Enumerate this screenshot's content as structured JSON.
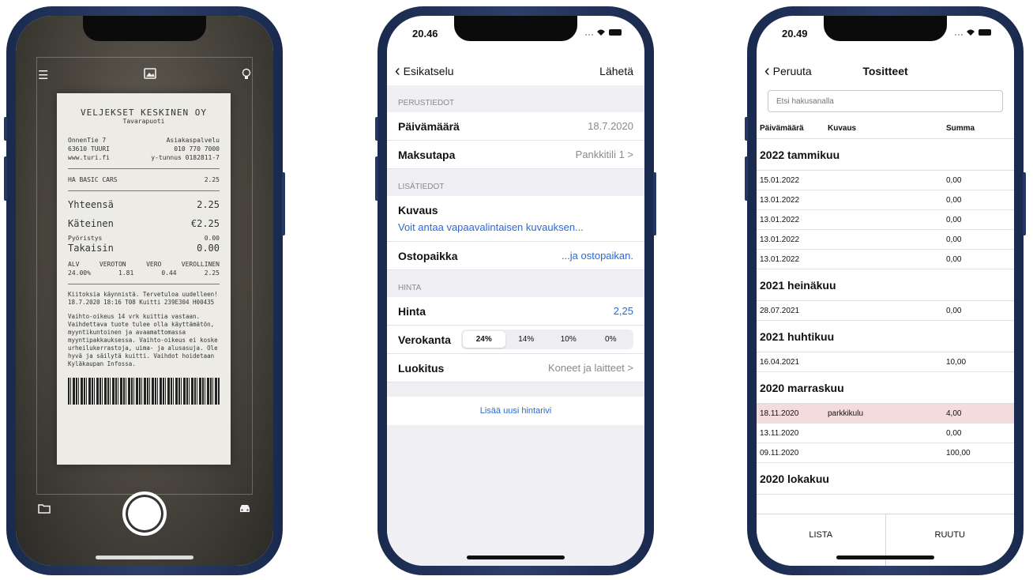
{
  "phone1": {
    "receipt": {
      "company": "VELJEKSET KESKINEN OY",
      "dept": "Tavarapuoti",
      "addr1": "OnnenTie 7",
      "addr2": "63610 TUURI",
      "web": "www.turi.fi",
      "cs1": "Asiakaspalvelu",
      "cs2": "010 770 7000",
      "ytunnus": "y-tunnus 0182811-7",
      "item": "HA BASIC CARS",
      "item_price": "2.25",
      "total_label": "Yhteensä",
      "total": "2.25",
      "cash_label": "Käteinen",
      "cash": "€2.25",
      "round_label": "Pyöristys",
      "round": "0.00",
      "back_label": "Takaisin",
      "back": "0.00",
      "tax_h1": "ALV",
      "tax_h2": "VEROTON",
      "tax_h3": "VERO",
      "tax_h4": "VEROLLINEN",
      "tax_v1": "24.00%",
      "tax_v2": "1.81",
      "tax_v3": "0.44",
      "tax_v4": "2.25",
      "thanks": "Kiitoksia käynnistä. Tervetuloa uudelleen! 18.7.2020 18:16 T08 Kuitti 239E304 H00435",
      "policy": "Vaihto-oikeus 14 vrk kuittia vastaan. Vaihdettava tuote tulee olla käyttämätön, myyntikuntoinen ja avaamattomassa myyntipakkauksessa. Vaihto-oikeus ei koske urheilukerrastoja, uima- ja alusasuja. Ole hyvä ja säilytä kuitti. Vaihdot hoidetaan Kyläkaupan Infossa."
    }
  },
  "phone2": {
    "time": "20.46",
    "back_label": "Esikatselu",
    "send_label": "Lähetä",
    "sec_basic": "PERUSTIEDOT",
    "date_label": "Päivämäärä",
    "date_value": "18.7.2020",
    "payment_label": "Maksutapa",
    "payment_value": "Pankkitili 1 >",
    "sec_extra": "LISÄTIEDOT",
    "desc_label": "Kuvaus",
    "desc_link": "Voit antaa vapaavalintaisen kuvauksen...",
    "place_label": "Ostopaikka",
    "place_link": "...ja ostopaikan.",
    "sec_price": "HINTA",
    "price_label": "Hinta",
    "price_value": "2,25",
    "tax_label": "Verokanta",
    "tax_options": [
      "24%",
      "14%",
      "10%",
      "0%"
    ],
    "class_label": "Luokitus",
    "class_value": "Koneet ja laitteet >",
    "add_row": "Lisää uusi hintarivi"
  },
  "phone3": {
    "time": "20.49",
    "cancel_label": "Peruuta",
    "title": "Tositteet",
    "search_placeholder": "Etsi hakusanalla",
    "col_date": "Päivämäärä",
    "col_desc": "Kuvaus",
    "col_sum": "Summa",
    "groups": [
      {
        "name": "2022 tammikuu",
        "rows": [
          {
            "date": "15.01.2022",
            "desc": "",
            "sum": "0,00"
          },
          {
            "date": "13.01.2022",
            "desc": "",
            "sum": "0,00"
          },
          {
            "date": "13.01.2022",
            "desc": "",
            "sum": "0,00"
          },
          {
            "date": "13.01.2022",
            "desc": "",
            "sum": "0,00"
          },
          {
            "date": "13.01.2022",
            "desc": "",
            "sum": "0,00"
          }
        ]
      },
      {
        "name": "2021 heinäkuu",
        "rows": [
          {
            "date": "28.07.2021",
            "desc": "",
            "sum": "0,00"
          }
        ]
      },
      {
        "name": "2021 huhtikuu",
        "rows": [
          {
            "date": "16.04.2021",
            "desc": "",
            "sum": "10,00"
          }
        ]
      },
      {
        "name": "2020 marraskuu",
        "rows": [
          {
            "date": "18.11.2020",
            "desc": "parkkikulu",
            "sum": "4,00"
          },
          {
            "date": "13.11.2020",
            "desc": "",
            "sum": "0,00"
          },
          {
            "date": "09.11.2020",
            "desc": "",
            "sum": "100,00"
          }
        ]
      },
      {
        "name": "2020 lokakuu",
        "rows": []
      }
    ],
    "tab_list": "LISTA",
    "tab_grid": "RUUTU"
  }
}
